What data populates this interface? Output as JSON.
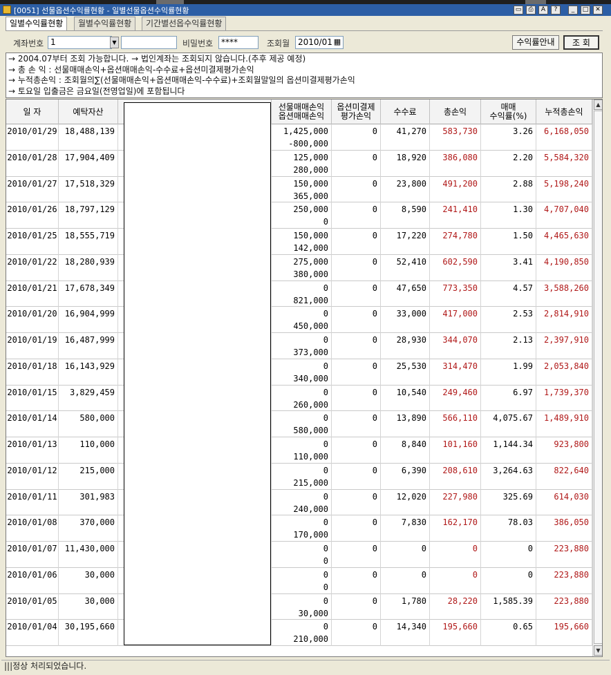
{
  "window": {
    "title": "[0051] 선물옵션수익률현황 - 일별선물옵션수익률현황"
  },
  "tabs": [
    {
      "label": "일별수익률현황",
      "active": true
    },
    {
      "label": "월별수익률현황",
      "active": false
    },
    {
      "label": "기간별선옵수익률현황",
      "active": false
    }
  ],
  "form": {
    "account_label": "계좌번호",
    "account_value": "1",
    "password_label": "비밀번호",
    "password_value": "****",
    "month_label": "조회월",
    "month_value": "2010/01",
    "guide_button": "수익률안내",
    "query_button": "조 회"
  },
  "notes": [
    "→ 2004.07부터 조회 가능합니다. → 법인계좌는 조회되지 않습니다.(추후 제공 예정)",
    "→ 총  손  익 : 선물매매손익+옵션매매손익-수수료+옵션미결제평가손익",
    "→ 누적총손익 : 조회월의∑(선물매매손익+옵션매매손익-수수료)+조회월말일의 옵션미결제평가손익",
    "→ 토요일 입출금은 금요일(전영업일)에 포함됩니다"
  ],
  "table": {
    "headers": {
      "date": "일 자",
      "deposit": "예탁자산",
      "pnl_line1": "선물매매손익",
      "pnl_line2": "옵션매매손익",
      "unsettled_line1": "옵션미결제",
      "unsettled_line2": "평가손익",
      "fee": "수수료",
      "total": "총손익",
      "rate_line1": "매매",
      "rate_line2": "수익률(%)",
      "cumulative": "누적총손익"
    },
    "rows": [
      {
        "date": "2010/01/29",
        "deposit": "18,488,139",
        "futures": "1,425,000",
        "options": "-800,000",
        "unsettled": "0",
        "fee": "41,270",
        "total": "583,730",
        "rate": "3.26",
        "cumulative": "6,168,050"
      },
      {
        "date": "2010/01/28",
        "deposit": "17,904,409",
        "futures": "125,000",
        "options": "280,000",
        "unsettled": "0",
        "fee": "18,920",
        "total": "386,080",
        "rate": "2.20",
        "cumulative": "5,584,320"
      },
      {
        "date": "2010/01/27",
        "deposit": "17,518,329",
        "futures": "150,000",
        "options": "365,000",
        "unsettled": "0",
        "fee": "23,800",
        "total": "491,200",
        "rate": "2.88",
        "cumulative": "5,198,240"
      },
      {
        "date": "2010/01/26",
        "deposit": "18,797,129",
        "futures": "250,000",
        "options": "0",
        "unsettled": "0",
        "fee": "8,590",
        "total": "241,410",
        "rate": "1.30",
        "cumulative": "4,707,040"
      },
      {
        "date": "2010/01/25",
        "deposit": "18,555,719",
        "futures": "150,000",
        "options": "142,000",
        "unsettled": "0",
        "fee": "17,220",
        "total": "274,780",
        "rate": "1.50",
        "cumulative": "4,465,630"
      },
      {
        "date": "2010/01/22",
        "deposit": "18,280,939",
        "futures": "275,000",
        "options": "380,000",
        "unsettled": "0",
        "fee": "52,410",
        "total": "602,590",
        "rate": "3.41",
        "cumulative": "4,190,850"
      },
      {
        "date": "2010/01/21",
        "deposit": "17,678,349",
        "futures": "0",
        "options": "821,000",
        "unsettled": "0",
        "fee": "47,650",
        "total": "773,350",
        "rate": "4.57",
        "cumulative": "3,588,260"
      },
      {
        "date": "2010/01/20",
        "deposit": "16,904,999",
        "futures": "0",
        "options": "450,000",
        "unsettled": "0",
        "fee": "33,000",
        "total": "417,000",
        "rate": "2.53",
        "cumulative": "2,814,910"
      },
      {
        "date": "2010/01/19",
        "deposit": "16,487,999",
        "futures": "0",
        "options": "373,000",
        "unsettled": "0",
        "fee": "28,930",
        "total": "344,070",
        "rate": "2.13",
        "cumulative": "2,397,910"
      },
      {
        "date": "2010/01/18",
        "deposit": "16,143,929",
        "futures": "0",
        "options": "340,000",
        "unsettled": "0",
        "fee": "25,530",
        "total": "314,470",
        "rate": "1.99",
        "cumulative": "2,053,840"
      },
      {
        "date": "2010/01/15",
        "deposit": "3,829,459",
        "futures": "0",
        "options": "260,000",
        "unsettled": "0",
        "fee": "10,540",
        "total": "249,460",
        "rate": "6.97",
        "cumulative": "1,739,370"
      },
      {
        "date": "2010/01/14",
        "deposit": "580,000",
        "futures": "0",
        "options": "580,000",
        "unsettled": "0",
        "fee": "13,890",
        "total": "566,110",
        "rate": "4,075.67",
        "cumulative": "1,489,910"
      },
      {
        "date": "2010/01/13",
        "deposit": "110,000",
        "futures": "0",
        "options": "110,000",
        "unsettled": "0",
        "fee": "8,840",
        "total": "101,160",
        "rate": "1,144.34",
        "cumulative": "923,800"
      },
      {
        "date": "2010/01/12",
        "deposit": "215,000",
        "futures": "0",
        "options": "215,000",
        "unsettled": "0",
        "fee": "6,390",
        "total": "208,610",
        "rate": "3,264.63",
        "cumulative": "822,640"
      },
      {
        "date": "2010/01/11",
        "deposit": "301,983",
        "futures": "0",
        "options": "240,000",
        "unsettled": "0",
        "fee": "12,020",
        "total": "227,980",
        "rate": "325.69",
        "cumulative": "614,030"
      },
      {
        "date": "2010/01/08",
        "deposit": "370,000",
        "futures": "0",
        "options": "170,000",
        "unsettled": "0",
        "fee": "7,830",
        "total": "162,170",
        "rate": "78.03",
        "cumulative": "386,050"
      },
      {
        "date": "2010/01/07",
        "deposit": "11,430,000",
        "futures": "0",
        "options": "0",
        "unsettled": "0",
        "fee": "0",
        "total": "0",
        "rate": "0",
        "cumulative": "223,880"
      },
      {
        "date": "2010/01/06",
        "deposit": "30,000",
        "futures": "0",
        "options": "0",
        "unsettled": "0",
        "fee": "0",
        "total": "0",
        "rate": "0",
        "cumulative": "223,880"
      },
      {
        "date": "2010/01/05",
        "deposit": "30,000",
        "futures": "0",
        "options": "30,000",
        "unsettled": "0",
        "fee": "1,780",
        "total": "28,220",
        "rate": "1,585.39",
        "cumulative": "223,880"
      },
      {
        "date": "2010/01/04",
        "deposit": "30,195,660",
        "futures": "0",
        "options": "210,000",
        "unsettled": "0",
        "fee": "14,340",
        "total": "195,660",
        "rate": "0.65",
        "cumulative": "195,660"
      }
    ]
  },
  "status": {
    "message": "정상 처리되었습니다."
  },
  "colors": {
    "profit_text": "#b01818",
    "title_bar": "#2c5ea5"
  },
  "icons": {
    "calendar": "calendar-icon",
    "dropdown": "chevron-down-icon"
  }
}
